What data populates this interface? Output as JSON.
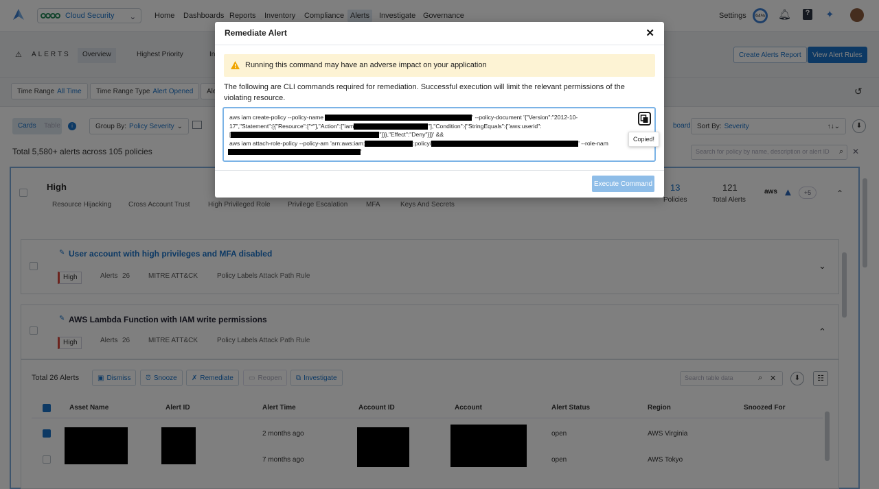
{
  "nav": {
    "product": "Cloud Security",
    "items": [
      "Home",
      "Dashboards",
      "Reports",
      "Inventory",
      "Compliance",
      "Alerts",
      "Investigate",
      "Governance"
    ],
    "active": "Alerts",
    "settings": "Settings",
    "progress_pct": "64%"
  },
  "subnav": {
    "section": "ALERTS",
    "tabs": [
      "Overview",
      "Highest Priority",
      "In"
    ],
    "create_report": "Create Alerts Report",
    "view_rules": "View Alert Rules"
  },
  "filters": [
    {
      "label": "Time Range",
      "value": "All Time"
    },
    {
      "label": "Time Range Type",
      "value": "Alert Opened"
    },
    {
      "label": "Ale",
      "value": ""
    }
  ],
  "toolbar": {
    "view_cards": "Cards",
    "view_table": "Table",
    "group_by_label": "Group By:",
    "group_by_value": "Policy Severity",
    "dashboard_partial": "board",
    "sort_by_label": "Sort By:",
    "sort_by_value": "Severity",
    "total": "Total 5,580+ alerts across 105 policies",
    "search_placeholder": "Search for policy by name, description or alert ID"
  },
  "severity_group": {
    "title": "High",
    "tags": [
      "Resource Hijacking",
      "Cross Account Trust",
      "High Privileged Role",
      "Privilege Escalation",
      "MFA",
      "Keys And Secrets"
    ],
    "policies_count": "13",
    "policies_label": "Policies",
    "alerts_count": "121",
    "alerts_label": "Total Alerts",
    "cloud_more": "+5"
  },
  "policies": [
    {
      "title": "User account with high privileges and MFA disabled",
      "severity": "High",
      "alerts_label": "Alerts",
      "alerts": "26",
      "mitre": "MITRE ATT&CK",
      "labels_label": "Policy Labels",
      "labels": "Attack Path Rule"
    },
    {
      "title": "AWS Lambda Function with IAM write permissions",
      "severity": "High",
      "alerts_label": "Alerts",
      "alerts": "26",
      "mitre": "MITRE ATT&CK",
      "labels_label": "Policy Labels",
      "labels": "Attack Path Rule"
    }
  ],
  "alerts_toolbar": {
    "total": "Total 26 Alerts",
    "dismiss": "Dismiss",
    "snooze": "Snooze",
    "remediate": "Remediate",
    "reopen": "Reopen",
    "investigate": "Investigate",
    "search_placeholder": "Search table data"
  },
  "table": {
    "columns": [
      "Asset Name",
      "Alert ID",
      "Alert Time",
      "Account ID",
      "Account",
      "Alert Status",
      "Region",
      "Snoozed For"
    ],
    "rows": [
      {
        "time": "2 months ago",
        "status": "open",
        "region": "AWS Virginia"
      },
      {
        "time": "7 months ago",
        "status": "open",
        "region": "AWS Tokyo"
      }
    ]
  },
  "modal": {
    "title": "Remediate Alert",
    "warning": "Running this command may have an adverse impact on your application",
    "description": "The following are CLI commands required for remediation. Successful execution will limit the relevant permissions of the violating resource.",
    "cmd_line1_a": "aws iam create-policy --policy-name",
    "cmd_line1_b": "' --policy-document '{\"Version\":\"2012-10-",
    "cmd_line2_a": "17\",\"Statement\":[{\"Resource\":[\"*\"],\"Action\":[\"iam",
    "cmd_line2_b": "\"],\"Condition\":{\"StringEquals\":{\"aws:userid\":",
    "cmd_line3_a": "[",
    "cmd_line3_b": "\"]}},\"Effect\":\"Deny\"}]}' &&",
    "cmd_line4_a": "aws iam attach-role-policy --policy-arn 'arn:aws:iam:",
    "cmd_line4_b": ":policy/",
    "cmd_line4_c": "' --role-nam",
    "cmd_line5_a": "'",
    "tooltip": "Copied!",
    "execute": "Execute Command"
  }
}
